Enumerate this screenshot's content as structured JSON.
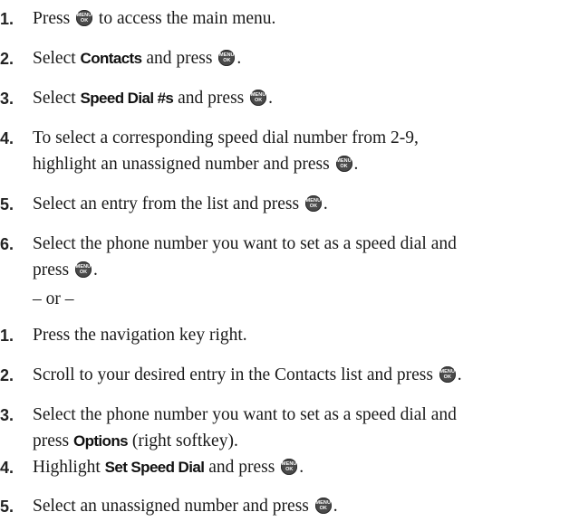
{
  "icon": {
    "name": "menu-ok-key-icon",
    "line1": "MENU",
    "line2": "OK"
  },
  "separator": "– or –",
  "steps_a": [
    {
      "num": "1.",
      "pre": "Press",
      "post": "to access the main menu."
    },
    {
      "num": "2.",
      "pre": "Select",
      "bold": "Contacts",
      "mid": "and press",
      "post": "."
    },
    {
      "num": "3.",
      "pre": "Select",
      "bold": "Speed Dial #s",
      "mid": "and press",
      "post": "."
    },
    {
      "num": "4.",
      "line1": "To select a corresponding speed dial number from 2-9,",
      "line2": "highlight an unassigned number and press",
      "post": "."
    },
    {
      "num": "5.",
      "pre": "Select an entry from the list and press",
      "post": "."
    },
    {
      "num": "6.",
      "line1": "Select the phone number you want to set as a speed dial and",
      "line2": "press",
      "post": "."
    }
  ],
  "steps_b": [
    {
      "num": "1.",
      "text": "Press the navigation key right."
    },
    {
      "num": "2.",
      "pre": "Scroll to your desired entry in the Contacts list and press",
      "post": "."
    },
    {
      "num": "3.",
      "line1": "Select the phone number you want to set as a speed dial and",
      "line2_pre": "press",
      "bold": "Options",
      "line2_post": "(right softkey)."
    },
    {
      "num": "4.",
      "pre": "Highlight",
      "bold": "Set Speed Dial",
      "mid": "and press",
      "post": "."
    },
    {
      "num": "5.",
      "pre": "Select an unassigned number and press",
      "post": "."
    }
  ]
}
